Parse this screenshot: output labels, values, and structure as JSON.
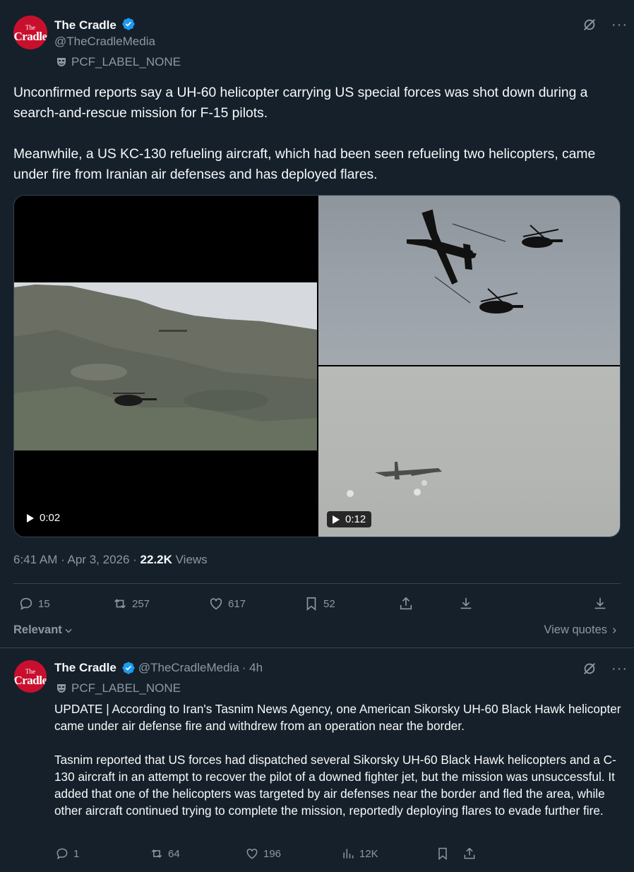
{
  "tweet": {
    "author_name": "The Cradle",
    "author_handle": "@TheCradleMedia",
    "avatar_text_top": "The",
    "avatar_text_bottom": "Cradle",
    "label": "PCF_LABEL_NONE",
    "text": "Unconfirmed reports say a UH-60 helicopter carrying US special forces was shot down during a search-and-rescue mission for F-15 pilots.\n\nMeanwhile, a US KC-130 refueling aircraft, which had been seen refueling two helicopters, came under fire from Iranian air defenses and has deployed flares.",
    "video_left_duration": "0:02",
    "video_right_duration": "0:12",
    "timestamp": "6:41 AM · Apr 3, 2026 · ",
    "views_count": "22.2K",
    "views_label": " Views",
    "replies": "15",
    "reposts": "257",
    "likes": "617",
    "bookmarks": "52"
  },
  "sort": {
    "relevant_label": "Relevant",
    "view_quotes_label": "View quotes"
  },
  "reply": {
    "author_name": "The Cradle",
    "author_handle": "@TheCradleMedia",
    "time": "· 4h",
    "label": "PCF_LABEL_NONE",
    "text": "UPDATE | According to Iran's Tasnim News Agency, one American Sikorsky UH-60 Black Hawk helicopter came under air defense fire and withdrew from an operation near the border.\n\nTasnim reported that US forces had dispatched several Sikorsky UH-60 Black Hawk helicopters and a C-130 aircraft in an attempt to recover the pilot of a downed fighter jet, but the mission was unsuccessful. It added that one of the helicopters was targeted by air defenses near the border and fled the area, while other aircraft continued trying to complete the mission, reportedly deploying flares to evade further fire.",
    "replies": "1",
    "reposts": "64",
    "likes": "196",
    "views": "12K"
  },
  "colors": {
    "background": "#15202b",
    "text": "#f7f9f9",
    "secondary": "#8b98a5",
    "verified": "#1d9bf0",
    "divider": "#38444d"
  }
}
